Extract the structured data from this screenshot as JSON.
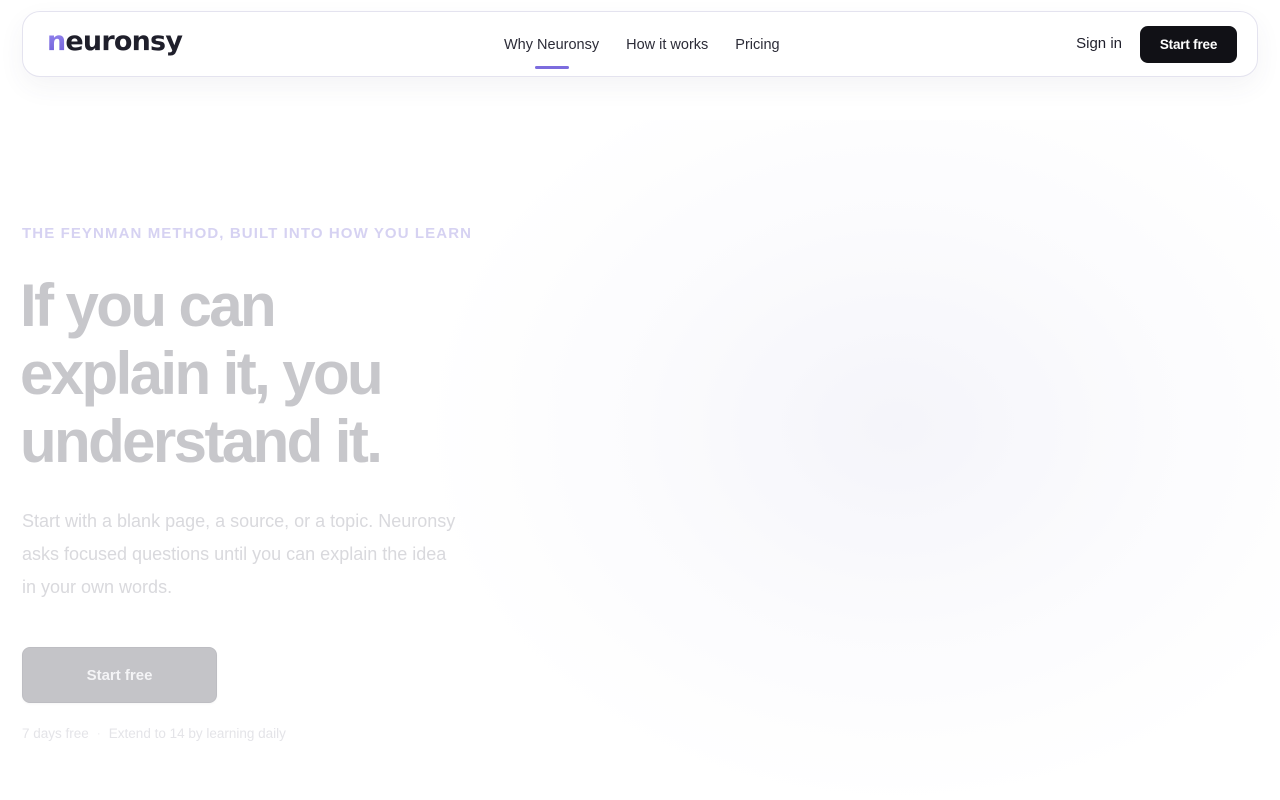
{
  "brand": {
    "logo_first": "n",
    "logo_rest": "euronsy",
    "accent_color": "#7c6cde"
  },
  "nav": {
    "links": [
      {
        "label": "Why Neuronsy",
        "active": true
      },
      {
        "label": "How it works",
        "active": false
      },
      {
        "label": "Pricing",
        "active": false
      }
    ],
    "sign_in": "Sign in",
    "cta": "Start free"
  },
  "hero": {
    "eyebrow": "THE FEYNMAN METHOD, BUILT INTO HOW YOU LEARN",
    "headline": [
      "If you can",
      "explain it, you",
      "understand it."
    ],
    "subtext": [
      "Start with a blank page, a source, or a topic. Neuronsy",
      "asks focused questions until you can explain the idea",
      "in your own words."
    ],
    "cta": "Start free",
    "trial_notes": [
      "7 days free",
      "·",
      "Extend to 14 by learning daily"
    ]
  }
}
